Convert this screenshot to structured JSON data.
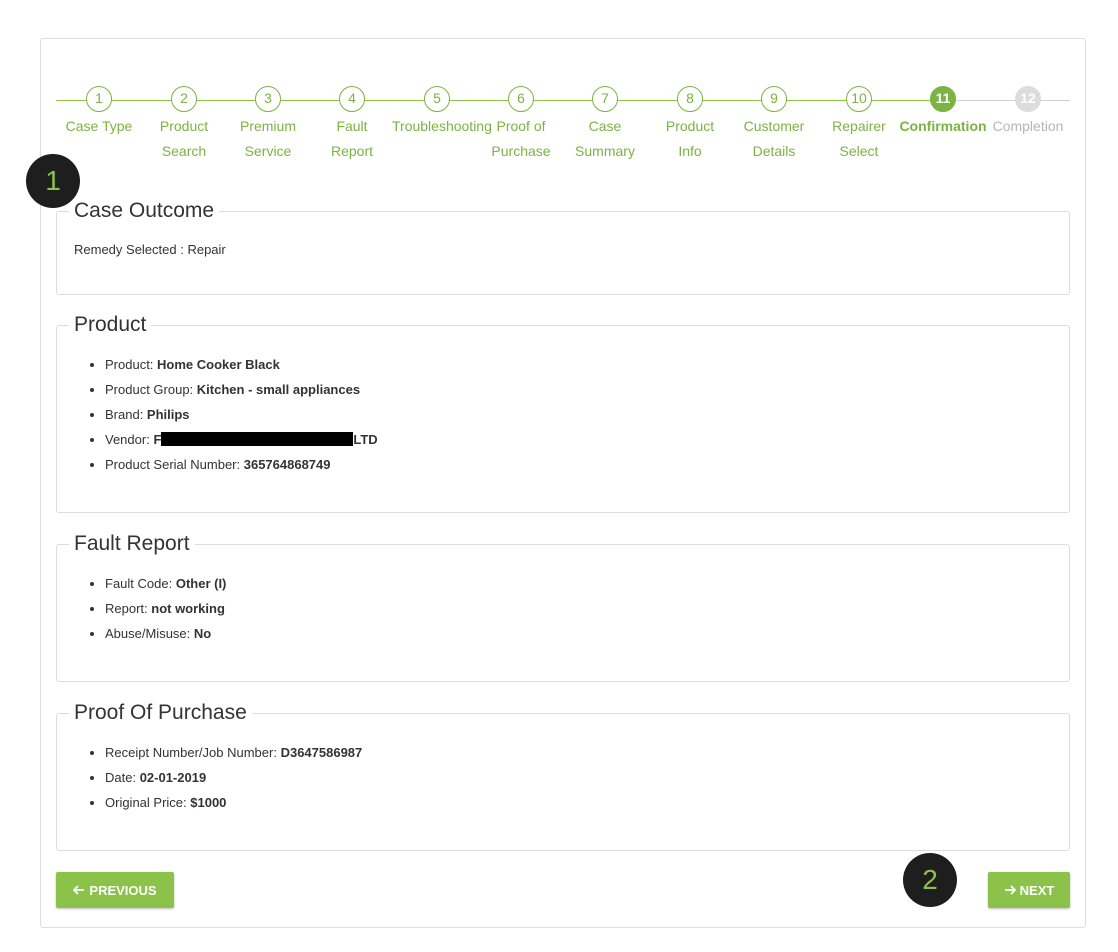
{
  "wizard": {
    "steps": [
      {
        "number": "1",
        "label": "Case Type"
      },
      {
        "number": "2",
        "label": "Product Search"
      },
      {
        "number": "3",
        "label": "Premium Service"
      },
      {
        "number": "4",
        "label": "Fault Report"
      },
      {
        "number": "5",
        "label": "Troubleshooting"
      },
      {
        "number": "6",
        "label": "Proof of Purchase"
      },
      {
        "number": "7",
        "label": "Case Summary"
      },
      {
        "number": "8",
        "label": "Product Info"
      },
      {
        "number": "9",
        "label": "Customer Details"
      },
      {
        "number": "10",
        "label": "Repairer Select"
      },
      {
        "number": "11",
        "label": "Confirmation"
      },
      {
        "number": "12",
        "label": "Completion"
      }
    ],
    "current_step": 11,
    "accent_color": "#7cb342",
    "inactive_color": "#dcdcdc"
  },
  "annotations": {
    "badge1": "1",
    "badge2": "2"
  },
  "case_outcome": {
    "title": "Case Outcome",
    "remedy_text": "Remedy Selected : Repair"
  },
  "product": {
    "title": "Product",
    "items": [
      {
        "label": "Product: ",
        "value": "Home Cooker Black"
      },
      {
        "label": "Product Group: ",
        "value": "Kitchen - small appliances"
      },
      {
        "label": "Brand: ",
        "value": "Philips"
      },
      {
        "label": "Vendor: ",
        "value_prefix": "F",
        "value_suffix": "LTD"
      },
      {
        "label": "Product Serial Number: ",
        "value": "365764868749"
      }
    ]
  },
  "fault_report": {
    "title": "Fault Report",
    "items": [
      {
        "label": "Fault Code: ",
        "value": "Other (I)"
      },
      {
        "label": "Report: ",
        "value": "not working"
      },
      {
        "label": "Abuse/Misuse: ",
        "value": "No"
      }
    ]
  },
  "proof_of_purchase": {
    "title": "Proof Of Purchase",
    "items": [
      {
        "label": "Receipt Number/Job Number: ",
        "value": "D3647586987"
      },
      {
        "label": "Date: ",
        "value": "02-01-2019"
      },
      {
        "label": "Original Price: ",
        "value": "$1000"
      }
    ]
  },
  "buttons": {
    "previous_icon": "arrow-left-icon",
    "previous_label": "PREVIOUS",
    "next_icon": "arrow-right-icon",
    "next_label": "NEXT",
    "color": "#8bc34a"
  }
}
